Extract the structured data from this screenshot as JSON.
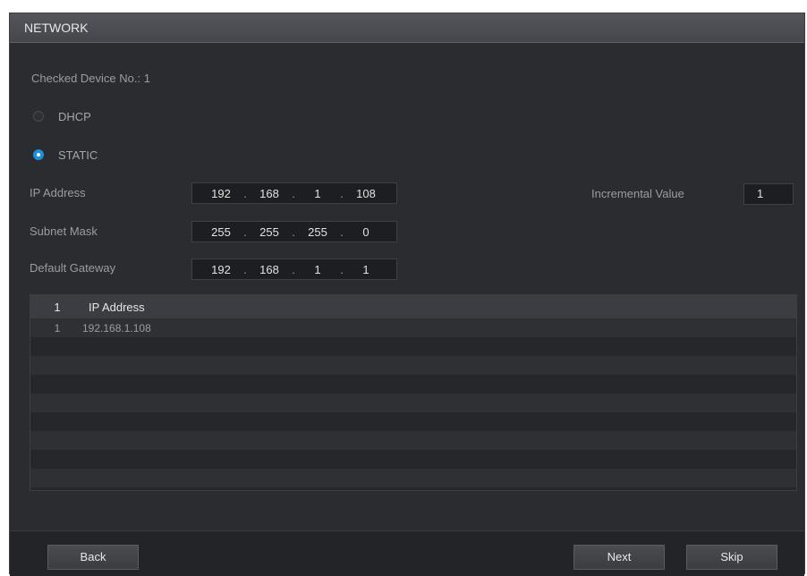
{
  "window": {
    "title": "NETWORK"
  },
  "form": {
    "checked_device": "Checked Device No.: 1",
    "dhcp_label": "DHCP",
    "static_label": "STATIC",
    "selected_mode": "STATIC",
    "ip_label": "IP Address",
    "subnet_label": "Subnet Mask",
    "gateway_label": "Default Gateway",
    "incremental_label": "Incremental Value",
    "incremental_value": "1",
    "ip": [
      "192",
      "168",
      "1",
      "108"
    ],
    "subnet": [
      "255",
      "255",
      "255",
      "0"
    ],
    "gateway": [
      "192",
      "168",
      "1",
      "1"
    ]
  },
  "table": {
    "headers": [
      "1",
      "IP Address"
    ],
    "rows": [
      [
        "1",
        "192.168.1.108"
      ]
    ]
  },
  "buttons": {
    "back": "Back",
    "next": "Next",
    "skip": "Skip"
  },
  "colors": {
    "accent": "#1e8fe0",
    "background": "#2b2c30"
  }
}
